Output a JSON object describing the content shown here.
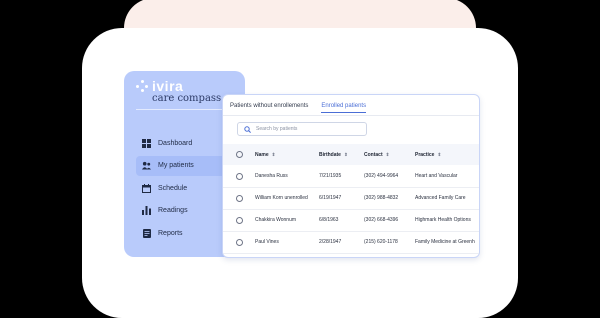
{
  "brand": {
    "name": "ivira",
    "tagline": "care compass"
  },
  "nav": [
    {
      "label": "Dashboard",
      "icon": "dashboard-icon"
    },
    {
      "label": "My patients",
      "icon": "patients-icon",
      "active": true
    },
    {
      "label": "Schedule",
      "icon": "calendar-icon"
    },
    {
      "label": "Readings",
      "icon": "bar-chart-icon"
    },
    {
      "label": "Reports",
      "icon": "report-icon"
    }
  ],
  "tabs": [
    {
      "label": "Patients without enrollements",
      "active": false
    },
    {
      "label": "Enrolled patients",
      "active": true
    }
  ],
  "search": {
    "placeholder": "Search by patients"
  },
  "table": {
    "headers": [
      "Name",
      "Birthdate",
      "Contact",
      "Practice"
    ],
    "rows": [
      [
        "Danesha Russ",
        "7/21/1935",
        "(302) 494-9964",
        "Heart and Vascular"
      ],
      [
        "William Korn unenrolled",
        "6/19/1947",
        "(302) 988-4832",
        "Advanced Family Care"
      ],
      [
        "Chakkira Wonnum",
        "6/8/1963",
        "(302) 668-4396",
        "Highmark Health Options"
      ],
      [
        "Paul Vines",
        "2/28/1947",
        "(215) 620-1178",
        "Family Medicine at Greenh"
      ]
    ]
  },
  "colors": {
    "sidebar": "#b9cbfb",
    "accent": "#4a6ed6",
    "blob": "#fbeeea"
  }
}
